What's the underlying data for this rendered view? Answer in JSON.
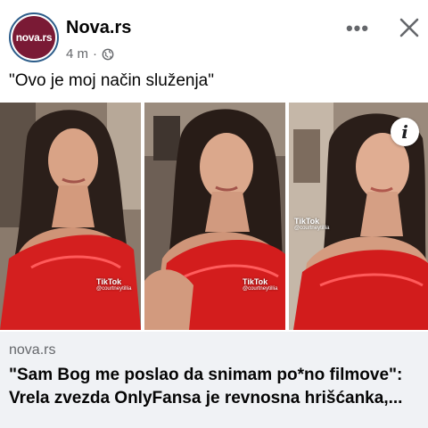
{
  "header": {
    "avatar_text": "nova.rs",
    "page_name": "Nova.rs",
    "time_ago": "4 m",
    "separator": "·",
    "privacy_icon": "globe-icon",
    "more_icon": "ellipsis-icon",
    "more_label": "•••",
    "close_icon": "close-icon",
    "brand_color": "#7a1a35"
  },
  "post": {
    "text": "\"Ovo je moj način služenja\""
  },
  "media": {
    "panels": [
      {
        "watermark": "TikTok",
        "handle": "@courtneytillia"
      },
      {
        "watermark": "TikTok",
        "handle": "@courtneytillia"
      },
      {
        "watermark": "TikTok",
        "handle": "@courtneytillia"
      }
    ],
    "info_icon": "info-icon",
    "info_label": "i"
  },
  "link": {
    "domain": "nova.rs",
    "title": "\"Sam Bog me poslao da snimam po*no filmove\": Vrela zvezda OnlyFansa je revnosna hrišćanka,..."
  }
}
